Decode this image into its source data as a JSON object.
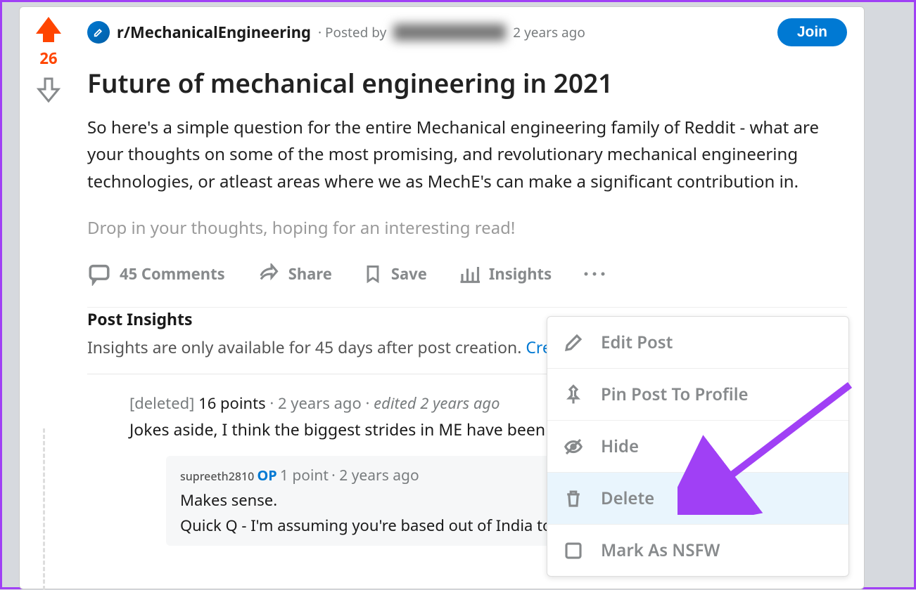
{
  "post": {
    "subreddit": "r/MechanicalEngineering",
    "posted_by_prefix": "· Posted by",
    "age": "2 years ago",
    "join_label": "Join",
    "score": "26",
    "title": "Future of mechanical engineering in 2021",
    "body1": "So here's a simple question for the entire Mechanical engineering family of Reddit - what are your thoughts on some of the most promising, and revolutionary mechanical engineering technologies, or atleast areas where we as MechE's can make a significant contribution in.",
    "body2": "Drop in your thoughts, hoping for an interesting read!"
  },
  "actions": {
    "comments": "45 Comments",
    "share": "Share",
    "save": "Save",
    "insights": "Insights"
  },
  "insights": {
    "heading": "Post Insights",
    "text": "Insights are only available for 45 days after post creation. ",
    "link": "Create"
  },
  "comment": {
    "user": "[deleted]",
    "points": "16 points",
    "sep": " · ",
    "age": "2 years ago",
    "sep2": " · ",
    "edited": "edited 2 years ago",
    "body": "Jokes aside, I think the biggest strides in ME have been m"
  },
  "reply": {
    "user": "supreeth2810",
    "op": "OP",
    "points": "1 point",
    "sep": " · ",
    "age": "2 years ago",
    "body1": "Makes sense.",
    "body2": "Quick Q - I'm assuming you're based out of India too,"
  },
  "menu": {
    "edit": "Edit Post",
    "pin": "Pin Post To Profile",
    "hide": "Hide",
    "delete": "Delete",
    "nsfw": "Mark As NSFW"
  }
}
